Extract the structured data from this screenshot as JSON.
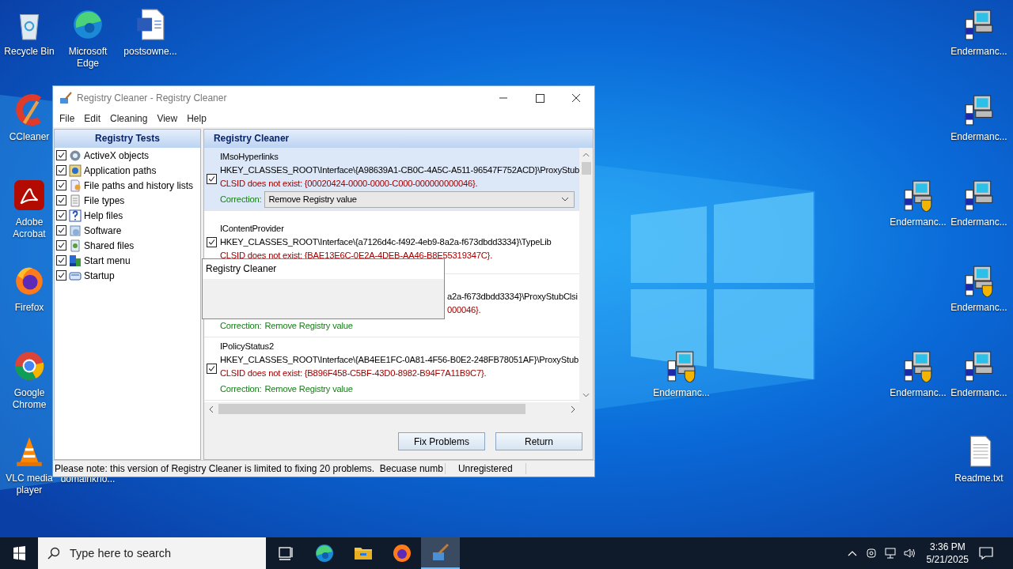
{
  "desktop_icons": [
    {
      "label": "Recycle Bin",
      "kind": "recycle"
    },
    {
      "label": "Microsoft Edge",
      "kind": "edge"
    },
    {
      "label": "postsowne...",
      "kind": "word"
    },
    {
      "label": "CCleaner",
      "kind": "ccleaner"
    },
    {
      "label": "Adobe Acrobat",
      "kind": "acrobat"
    },
    {
      "label": "Firefox",
      "kind": "firefox"
    },
    {
      "label": "Google Chrome",
      "kind": "chrome"
    },
    {
      "label": "VLC media player",
      "kind": "vlc"
    },
    {
      "label": "domainkno...",
      "kind": "hidden"
    },
    {
      "label": "Endermanc...",
      "kind": "installer"
    },
    {
      "label": "Endermanc...",
      "kind": "installer"
    },
    {
      "label": "Endermanc...",
      "kind": "setup"
    },
    {
      "label": "Endermanc...",
      "kind": "installer"
    },
    {
      "label": "Endermanc...",
      "kind": "setup"
    },
    {
      "label": "Endermanc...",
      "kind": "setup"
    },
    {
      "label": "Endermanc...",
      "kind": "setup"
    },
    {
      "label": "Endermanc...",
      "kind": "installer"
    },
    {
      "label": "Readme.txt",
      "kind": "text"
    }
  ],
  "window": {
    "title": "Registry Cleaner - Registry Cleaner",
    "menu": [
      "File",
      "Edit",
      "Cleaning",
      "View",
      "Help"
    ],
    "tests": {
      "header": "Registry Tests",
      "items": [
        {
          "label": "ActiveX objects",
          "checked": true
        },
        {
          "label": "Application paths",
          "checked": true
        },
        {
          "label": "File paths and history lists",
          "checked": true
        },
        {
          "label": "File types",
          "checked": true
        },
        {
          "label": "Help files",
          "checked": true
        },
        {
          "label": "Software",
          "checked": true
        },
        {
          "label": "Shared files",
          "checked": true
        },
        {
          "label": "Start menu",
          "checked": true
        },
        {
          "label": "Startup",
          "checked": true
        }
      ]
    },
    "results": {
      "header": "Registry Cleaner",
      "entries": [
        {
          "kind": "full",
          "name": "IMsoHyperlinks",
          "key": "HKEY_CLASSES_ROOT\\Interface\\{A98639A1-CB0C-4A5C-A511-96547F752ACD}\\ProxyStub",
          "error": "CLSID does not exist: {00020424-0000-0000-C000-000000000046}.",
          "correction_label": "Correction:",
          "correction": "Remove Registry value",
          "checked": true,
          "selected": true
        },
        {
          "kind": "full",
          "name": "IContentProvider",
          "key": "HKEY_CLASSES_ROOT\\Interface\\{a7126d4c-f492-4eb9-8a2a-f673dbdd3334}\\TypeLib",
          "error": "CLSID does not exist: {BAE13E6C-0E2A-4DEB-AA46-B8E55319347C}.",
          "checked": true,
          "selected": false
        },
        {
          "kind": "partial",
          "key": "a2a-f673dbdd3334}\\ProxyStubClsi",
          "error": "000046}.",
          "correction_label": "Correction:",
          "correction": "Remove Registry value",
          "selected": false
        },
        {
          "kind": "full",
          "name": "IPolicyStatus2",
          "key": "HKEY_CLASSES_ROOT\\Interface\\{AB4EE1FC-0A81-4F56-B0E2-248FB78051AF}\\ProxyStub",
          "error": "CLSID does not exist: {B896F458-C5BF-43D0-8982-B94F7A11B9C7}.",
          "correction_label": "Correction:",
          "correction": "Remove Registry value",
          "checked": true,
          "selected": false
        }
      ]
    },
    "buttons": [
      "Fix Problems",
      "Return"
    ],
    "status_bar": {
      "note": "Please note: this version of Registry Cleaner is limited to fixing 20 problems.  Becuase numb",
      "registration": "Unregistered"
    }
  },
  "popup": {
    "title": "Registry Cleaner"
  },
  "taskbar": {
    "search": {
      "placeholder": "Type here to search"
    },
    "apps": [
      {
        "kind": "taskview",
        "active": false
      },
      {
        "kind": "edge",
        "active": false
      },
      {
        "kind": "explorer",
        "active": false
      },
      {
        "kind": "firefox",
        "active": false
      },
      {
        "kind": "cleaner",
        "active": true
      }
    ],
    "time": "3:36 PM",
    "date": "5/21/2025"
  }
}
